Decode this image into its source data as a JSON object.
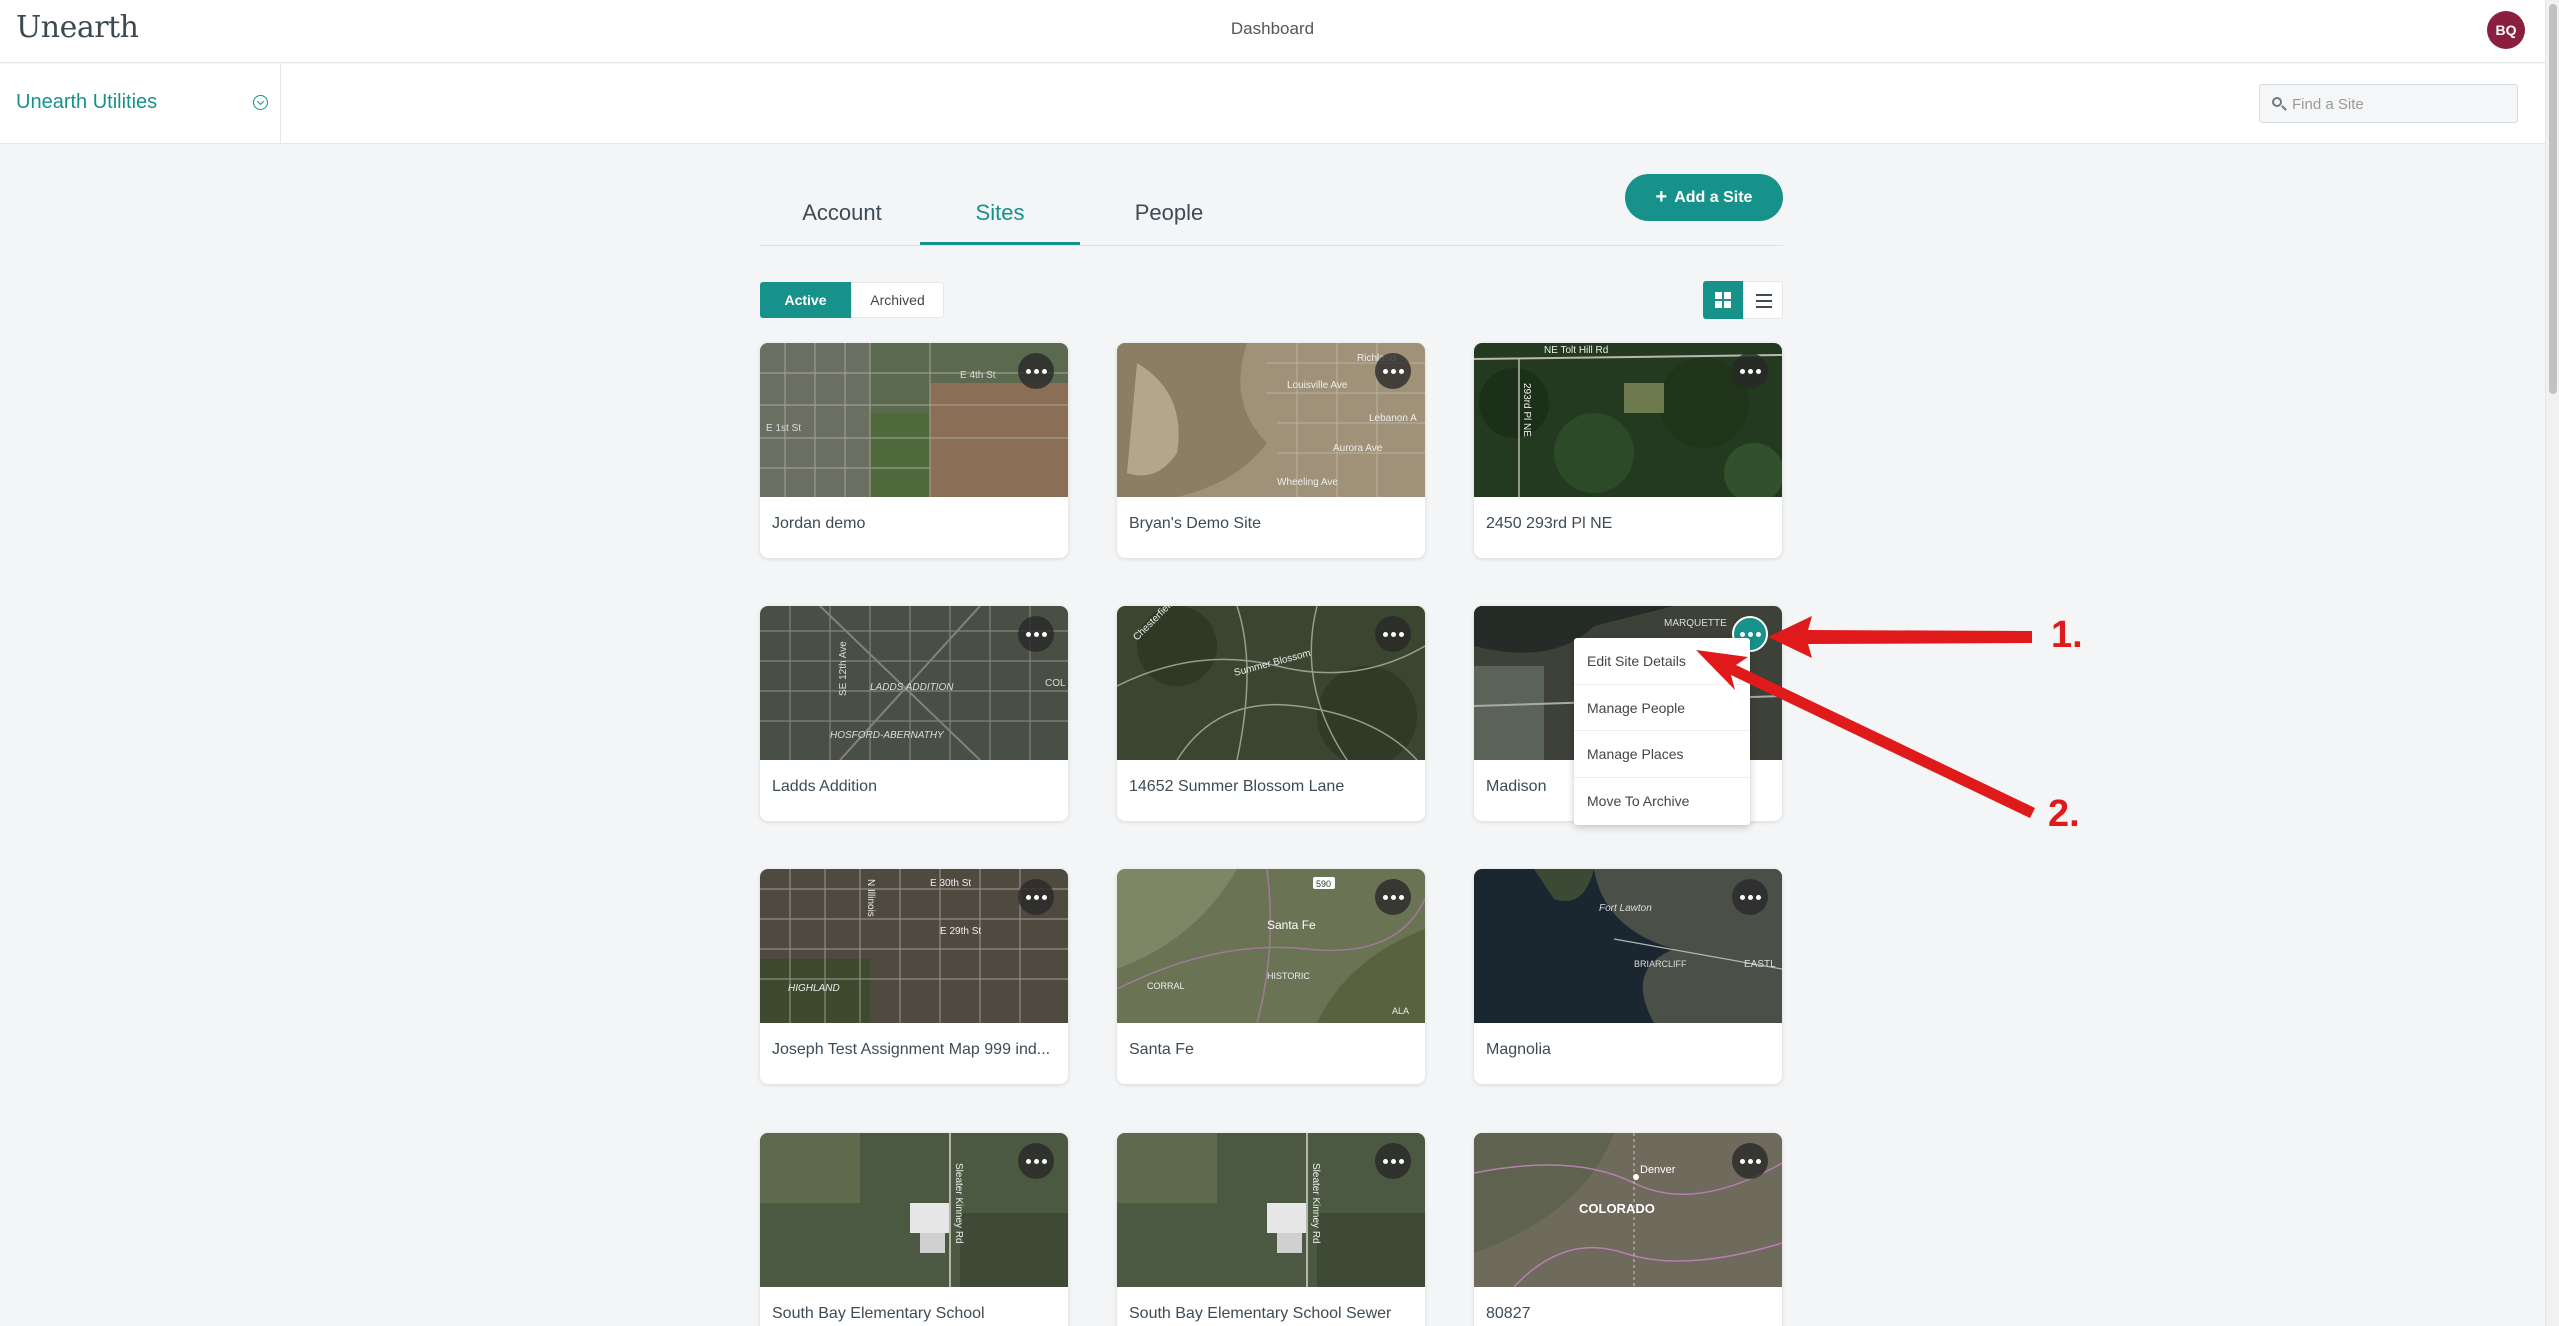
{
  "app": {
    "logo": "Unearth",
    "page_title": "Dashboard",
    "avatar_initials": "BQ",
    "org_name": "Unearth Utilities",
    "search_placeholder": "Find a Site"
  },
  "tabs": [
    {
      "label": "Account",
      "active": false
    },
    {
      "label": "Sites",
      "active": true
    },
    {
      "label": "People",
      "active": false
    }
  ],
  "add_site_label": "Add a Site",
  "filters": {
    "active": "Active",
    "archived": "Archived"
  },
  "sites": [
    {
      "name": "Jordan demo",
      "map": "farm-grid"
    },
    {
      "name": "Bryan's Demo Site",
      "map": "desert-town"
    },
    {
      "name": "2450 293rd Pl NE",
      "map": "forest"
    },
    {
      "name": "Ladds Addition",
      "map": "city-diagonal"
    },
    {
      "name": "14652 Summer Blossom Lane",
      "map": "suburb"
    },
    {
      "name": "Madison",
      "map": "waterfront"
    },
    {
      "name": "Joseph Test Assignment Map 999 ind...",
      "map": "city-grid"
    },
    {
      "name": "Santa Fe",
      "map": "mountains"
    },
    {
      "name": "Magnolia",
      "map": "coast"
    },
    {
      "name": "South Bay Elementary School",
      "map": "school"
    },
    {
      "name": "South Bay Elementary School Sewer",
      "map": "school"
    },
    {
      "name": "80827",
      "map": "state"
    }
  ],
  "map_labels": {
    "jordan": [
      "E 4th St",
      "E 1st St"
    ],
    "bryan": [
      "Richland",
      "Louisville Ave",
      "Lebanon A",
      "Aurora Ave",
      "Wheeling Ave"
    ],
    "forest": [
      "NE Tolt Hill Rd",
      "293rd Pl NE"
    ],
    "ladds": [
      "SE 12th Ave",
      "LADDS ADDITION",
      "HOSFORD-ABERNATHY",
      "COL"
    ],
    "suburb": [
      "Chesterfield",
      "Summer Blossom"
    ],
    "madison": [
      "MARQUETTE"
    ],
    "joseph": [
      "E 30th St",
      "E 29th St",
      "HIGHLAND",
      "N Illinois"
    ],
    "santafe": [
      "Santa Fe",
      "CORRAL",
      "HISTORIC",
      "ALA",
      "590"
    ],
    "magnolia": [
      "Fort Lawton",
      "BRIARCLIFF",
      "EASTL"
    ],
    "school": [
      "Sleater Kinney Rd"
    ],
    "state": [
      "Denver",
      "COLORADO"
    ]
  },
  "context_menu": [
    "Edit Site Details",
    "Manage People",
    "Manage Places",
    "Move To Archive"
  ],
  "annotations": {
    "one": "1.",
    "two": "2."
  },
  "colors": {
    "accent": "#17928a",
    "avatar": "#8b1f3f",
    "annotation": "#e01a1a"
  }
}
